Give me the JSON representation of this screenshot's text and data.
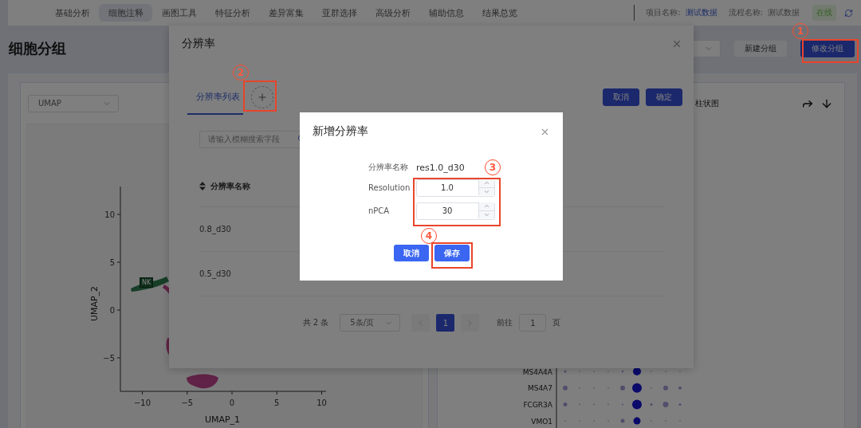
{
  "nav": {
    "tabs": [
      {
        "label": "基础分析",
        "selected": false
      },
      {
        "label": "细胞注释",
        "selected": true
      },
      {
        "label": "画图工具",
        "selected": false
      },
      {
        "label": "特征分析",
        "selected": false
      },
      {
        "label": "差异富集",
        "selected": false
      },
      {
        "label": "亚群选择",
        "selected": false
      },
      {
        "label": "高级分析",
        "selected": false
      },
      {
        "label": "辅助信息",
        "selected": false
      },
      {
        "label": "结果总览",
        "selected": false
      }
    ],
    "project_label": "项目名称:",
    "project_value": "测试数据",
    "flow_label": "流程名称:",
    "flow_value": "测试数据",
    "status": "在线"
  },
  "header": {
    "title": "细胞分组",
    "buttons": [
      {
        "label": "新建分组",
        "kind": "default"
      },
      {
        "label": "修改分组",
        "kind": "primary"
      }
    ]
  },
  "left_card": {
    "reduction_select": "UMAP",
    "plot": {
      "x_title": "UMAP_1",
      "y_title": "UMAP_2",
      "cluster_label": "NK",
      "x_ticks": [
        "−10",
        "−5",
        "0",
        "5",
        "10"
      ],
      "y_ticks": [
        "10",
        "5",
        "0",
        "−5"
      ]
    }
  },
  "right_card": {
    "title": "柱状图",
    "genes": [
      "MS4A4A",
      "MS4A7",
      "FCGR3A",
      "VMO1"
    ]
  },
  "resolution_dialog": {
    "title": "分辨率",
    "tabs": [
      {
        "label": "分辨率列表",
        "selected": true
      }
    ],
    "buttons": [
      "取消",
      "确定"
    ],
    "search": {
      "placeholder": "请输入模糊搜索字段"
    },
    "table": {
      "columns": [
        "分辨率名称"
      ],
      "rows": [
        [
          "0.8_d30"
        ],
        [
          "0.5_d30"
        ]
      ]
    },
    "pagination": {
      "total": "共 2 条",
      "page_size": "5条/页",
      "pages": [
        {
          "label": "1",
          "selected": true
        }
      ],
      "goto_label": "前往",
      "goto_value": "1",
      "goto_suffix": "页"
    }
  },
  "add_dialog": {
    "title": "新增分辨率",
    "fields": [
      {
        "label": "分辨率名称",
        "kind": "text",
        "value": "res1.0_d30"
      },
      {
        "label": "Resolution",
        "kind": "number",
        "value": "1.0"
      },
      {
        "label": "nPCA",
        "kind": "number",
        "value": "30"
      }
    ],
    "buttons": [
      "取消",
      "保存"
    ]
  },
  "annotations": [
    {
      "label": "1"
    },
    {
      "label": "2"
    },
    {
      "label": "3"
    },
    {
      "label": "4"
    }
  ]
}
